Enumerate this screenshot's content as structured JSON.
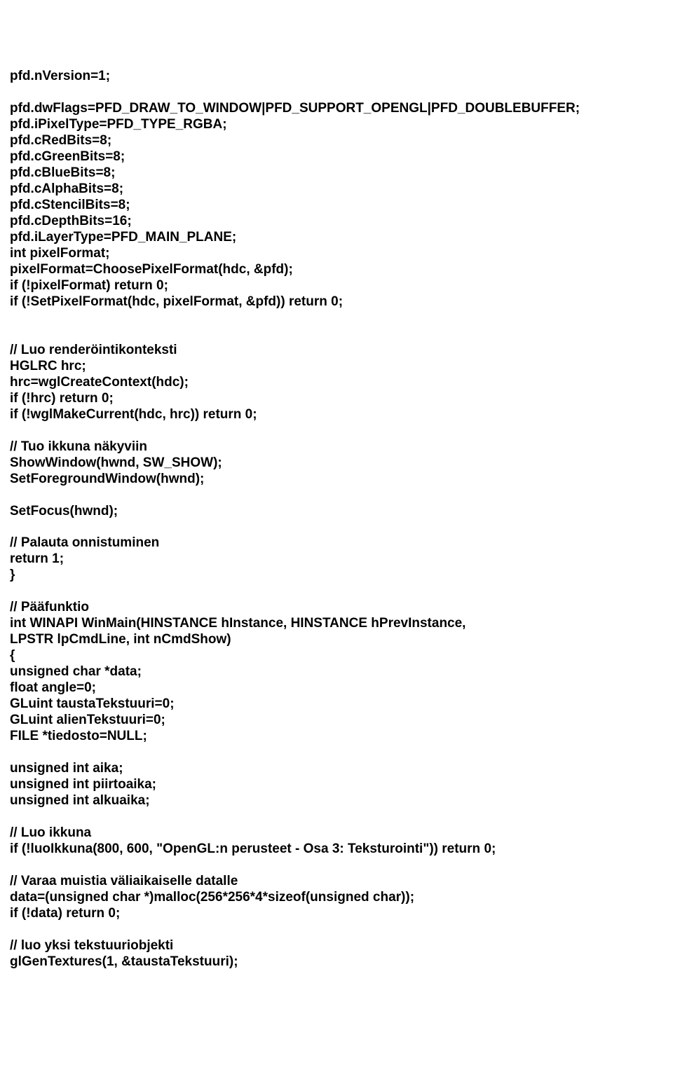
{
  "code": {
    "lines": [
      "pfd.nVersion=1;",
      "",
      "pfd.dwFlags=PFD_DRAW_TO_WINDOW|PFD_SUPPORT_OPENGL|PFD_DOUBLEBUFFER;",
      "pfd.iPixelType=PFD_TYPE_RGBA;",
      "pfd.cRedBits=8;",
      "pfd.cGreenBits=8;",
      "pfd.cBlueBits=8;",
      "pfd.cAlphaBits=8;",
      "pfd.cStencilBits=8;",
      "pfd.cDepthBits=16;",
      "pfd.iLayerType=PFD_MAIN_PLANE;",
      "int pixelFormat;",
      "pixelFormat=ChoosePixelFormat(hdc, &pfd);",
      "if (!pixelFormat) return 0;",
      "if (!SetPixelFormat(hdc, pixelFormat, &pfd)) return 0;",
      "",
      "",
      "// Luo renderöintikonteksti",
      "HGLRC hrc;",
      "hrc=wglCreateContext(hdc);",
      "if (!hrc) return 0;",
      "if (!wglMakeCurrent(hdc, hrc)) return 0;",
      "",
      "// Tuo ikkuna näkyviin",
      "ShowWindow(hwnd, SW_SHOW);",
      "SetForegroundWindow(hwnd);",
      "",
      "SetFocus(hwnd);",
      "",
      "// Palauta onnistuminen",
      "return 1;",
      "}",
      "",
      "// Pääfunktio",
      "int WINAPI WinMain(HINSTANCE hInstance, HINSTANCE hPrevInstance,",
      "LPSTR lpCmdLine, int nCmdShow)",
      "{",
      "unsigned char *data;",
      "float angle=0;",
      "GLuint taustaTekstuuri=0;",
      "GLuint alienTekstuuri=0;",
      "FILE *tiedosto=NULL;",
      "",
      "unsigned int aika;",
      "unsigned int piirtoaika;",
      "unsigned int alkuaika;",
      "",
      "// Luo ikkuna",
      "if (!luoIkkuna(800, 600, \"OpenGL:n perusteet - Osa 3: Teksturointi\")) return 0;",
      "",
      "// Varaa muistia väliaikaiselle datalle",
      "data=(unsigned char *)malloc(256*256*4*sizeof(unsigned char));",
      "if (!data) return 0;",
      "",
      "// luo yksi tekstuuriobjekti",
      "glGenTextures(1, &taustaTekstuuri);"
    ]
  }
}
